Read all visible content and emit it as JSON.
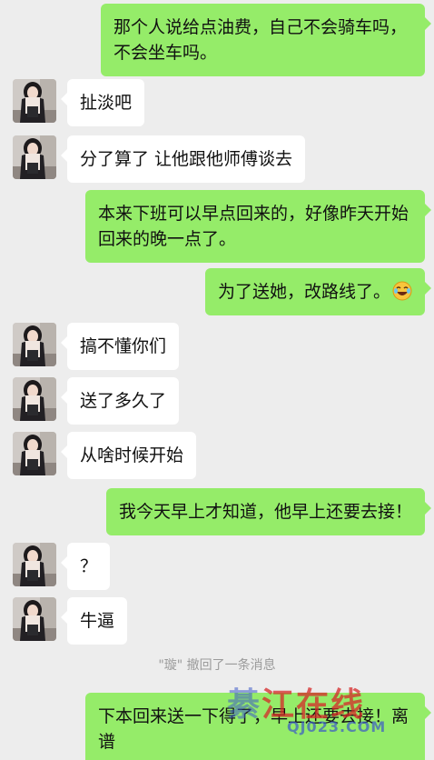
{
  "messages": [
    {
      "side": "out",
      "text": "那个人说给点油费，自己不会骑车吗，不会坐车吗。"
    },
    {
      "side": "in",
      "text": "扯淡吧"
    },
    {
      "side": "in",
      "text": "分了算了 让他跟他师傅谈去"
    },
    {
      "side": "out",
      "text": "本来下班可以早点回来的，好像昨天开始回来的晚一点了。"
    },
    {
      "side": "out",
      "text": "为了送她，改路线了。",
      "emoji": "laugh-cry-emoji"
    },
    {
      "side": "in",
      "text": "搞不懂你们"
    },
    {
      "side": "in",
      "text": "送了多久了"
    },
    {
      "side": "in",
      "text": "从啥时候开始"
    },
    {
      "side": "out",
      "text": "我今天早上才知道，他早上还要去接！"
    },
    {
      "side": "in",
      "text": "？"
    },
    {
      "side": "in",
      "text": "牛逼"
    },
    {
      "side": "system",
      "text": "\"璇\" 撤回了一条消息"
    },
    {
      "side": "out",
      "text": "下本回来送一下得了，早上还要去接！离谱"
    }
  ],
  "watermark": {
    "main_blue": "綦",
    "main_red": "江在线",
    "sub": "QJ023.COM"
  },
  "colors": {
    "background": "#ededed",
    "outgoing_bubble": "#95ec69",
    "incoming_bubble": "#ffffff",
    "system_text": "#9b9b9b"
  }
}
